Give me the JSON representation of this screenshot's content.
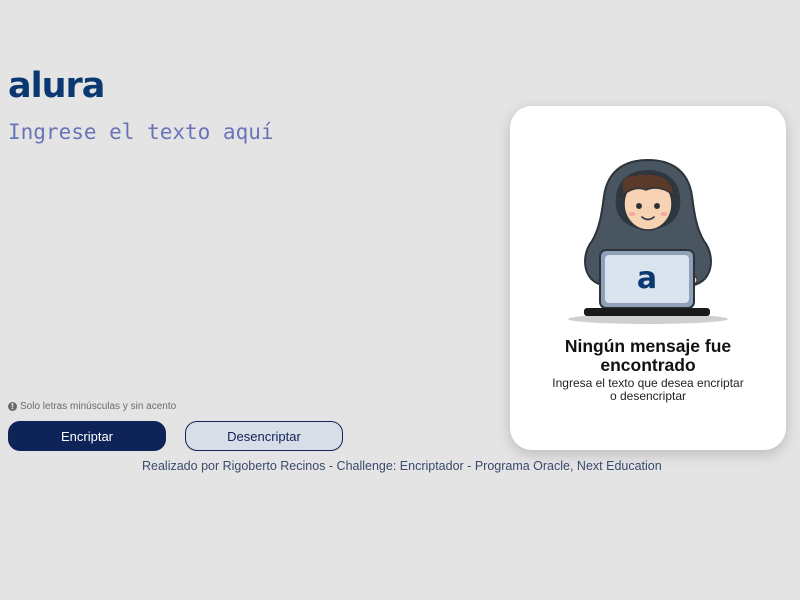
{
  "logo": {
    "text": "alura"
  },
  "input": {
    "placeholder": "Ingrese el texto aquí",
    "value": ""
  },
  "hint": {
    "icon": "info-icon",
    "text": "Solo letras minúsculas y sin acento"
  },
  "buttons": {
    "encrypt": "Encriptar",
    "decrypt": "Desencriptar"
  },
  "footer": {
    "text": "Realizado por Rigoberto Recinos - Challenge: Encriptador - Programa Oracle, Next Education"
  },
  "result_card": {
    "illustration": "hooded-person-with-laptop",
    "laptop_logo": "a",
    "title_line1": "Ningún mensaje fue",
    "title_line2": "encontrado",
    "subtitle_line1": "Ingresa el texto que desea encriptar",
    "subtitle_line2": "o desencriptar"
  },
  "colors": {
    "background": "#e4e4e5",
    "brand": "#0a3871",
    "primary_button": "#0e2358",
    "secondary_button": "#d8dee8",
    "placeholder": "#6a74b8"
  }
}
